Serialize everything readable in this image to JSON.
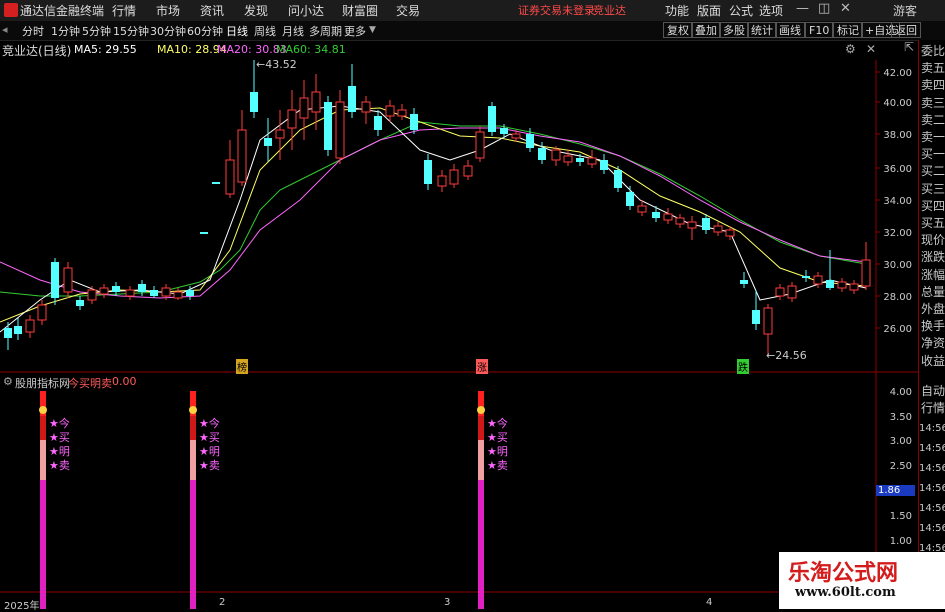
{
  "titlebar": {
    "app_title": "通达信金融终端",
    "menus": [
      "行情",
      "市场",
      "资讯",
      "发现",
      "问小达",
      "财富圈",
      "交易"
    ],
    "login_warning": "证券交易未登录",
    "login_link": "竞业达",
    "sys_menus": [
      "功能",
      "版面",
      "公式",
      "选项"
    ],
    "guest": "游客"
  },
  "toolbar": {
    "periods": [
      "分时",
      "1分钟",
      "5分钟",
      "15分钟",
      "30分钟",
      "60分钟",
      "日线",
      "周线",
      "月线",
      "多周期",
      "更多"
    ],
    "active_period": "日线",
    "right_buttons": [
      "复权",
      "叠加",
      "多股",
      "统计",
      "画线",
      "F10",
      "标记",
      "+自选",
      "返回"
    ]
  },
  "chart_header": {
    "stock": "竞业达(日线)",
    "ma5": "MA5: 29.55",
    "ma10": "MA10: 28.94",
    "ma20": "MA20: 30.83",
    "ma60": "MA60: 34.81"
  },
  "price_axis": [
    "42.00",
    "40.00",
    "38.00",
    "36.00",
    "34.00",
    "32.00",
    "30.00",
    "28.00",
    "26.00"
  ],
  "annotations": {
    "high": "43.52",
    "low": "24.56",
    "tags": [
      "榜",
      "涨",
      "跌"
    ]
  },
  "indicator": {
    "name": "股朋指标网",
    "title": "今买明卖",
    "value": "0.00",
    "signal_text": [
      "今",
      "买",
      "明",
      "卖"
    ],
    "axis": [
      "4.00",
      "3.50",
      "3.00",
      "2.50",
      "2.00",
      "1.50",
      "1.00"
    ],
    "current": "1.86"
  },
  "date_axis": [
    "2025年",
    "2",
    "3",
    "4"
  ],
  "right_panel": {
    "items": [
      "委比",
      "卖五",
      "卖四",
      "卖三",
      "卖二",
      "卖一",
      "买一",
      "买二",
      "买三",
      "买四",
      "买五",
      "现价",
      "涨跌",
      "涨幅",
      "总量",
      "外盘",
      "换手",
      "净资",
      "收益"
    ],
    "bottom": [
      "自动",
      "行情"
    ],
    "times": [
      "14:56",
      "14:56",
      "14:56",
      "14:56",
      "14:56",
      "14:56",
      "14:56",
      "14:56",
      "14:56"
    ]
  },
  "watermark": {
    "title": "乐淘公式网",
    "url": "www.60lt.com"
  },
  "colors": {
    "up": "#ff3c3c",
    "down": "#54ffff",
    "ma5": "#ffffff",
    "ma10": "#ffff66",
    "ma20": "#ff66ff",
    "ma60": "#33cc33",
    "signal": "#ff00ff"
  }
}
